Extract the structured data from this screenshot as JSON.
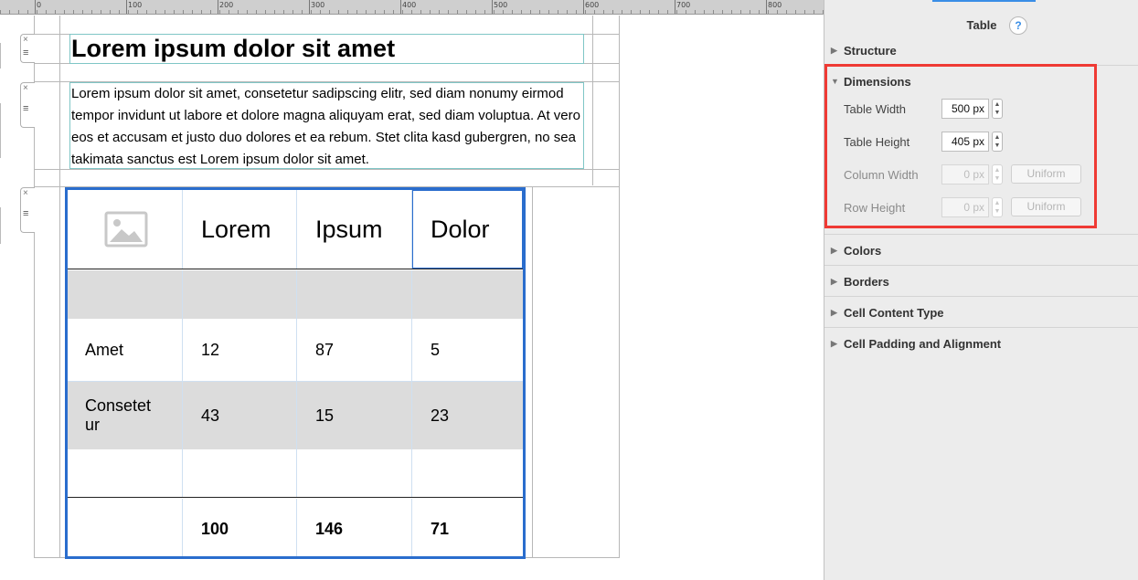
{
  "ruler": {
    "labels": [
      "0",
      "100",
      "200",
      "300",
      "400",
      "500",
      "600",
      "700",
      "800"
    ]
  },
  "editor": {
    "heading": "Lorem ipsum dolor sit amet",
    "paragraph": "Lorem ipsum dolor sit amet, consetetur sadipscing elitr, sed diam nonumy eirmod tempor invidunt ut labore et dolore magna aliquyam erat, sed diam voluptua. At vero eos et accusam et justo duo dolores et ea rebum. Stet clita kasd gubergren, no sea takimata sanctus est Lorem ipsum dolor sit amet.",
    "handle_close": "×",
    "handle_menu": "≡",
    "table": {
      "header": [
        "",
        "Lorem",
        "Ipsum",
        "Dolor"
      ],
      "rows": [
        [
          "",
          "",
          "",
          ""
        ],
        [
          "Amet",
          "12",
          "87",
          "5"
        ],
        [
          "Consetet ur",
          "43",
          "15",
          "23"
        ],
        [
          "",
          "",
          "",
          ""
        ]
      ],
      "footer": [
        "",
        "100",
        "146",
        "71"
      ]
    }
  },
  "panel": {
    "title": "Table",
    "help": "?",
    "sections": {
      "structure": "Structure",
      "dimensions": "Dimensions",
      "colors": "Colors",
      "borders": "Borders",
      "cell_content_type": "Cell Content Type",
      "cell_padding": "Cell Padding and Alignment"
    },
    "dimensions": {
      "table_width_label": "Table Width",
      "table_width_value": "500 px",
      "table_height_label": "Table Height",
      "table_height_value": "405 px",
      "column_width_label": "Column Width",
      "column_width_value": "0 px",
      "row_height_label": "Row Height",
      "row_height_value": "0 px",
      "uniform_label": "Uniform"
    },
    "highlight_color": "#ef3a34",
    "accent_color": "#2a6dcd"
  }
}
